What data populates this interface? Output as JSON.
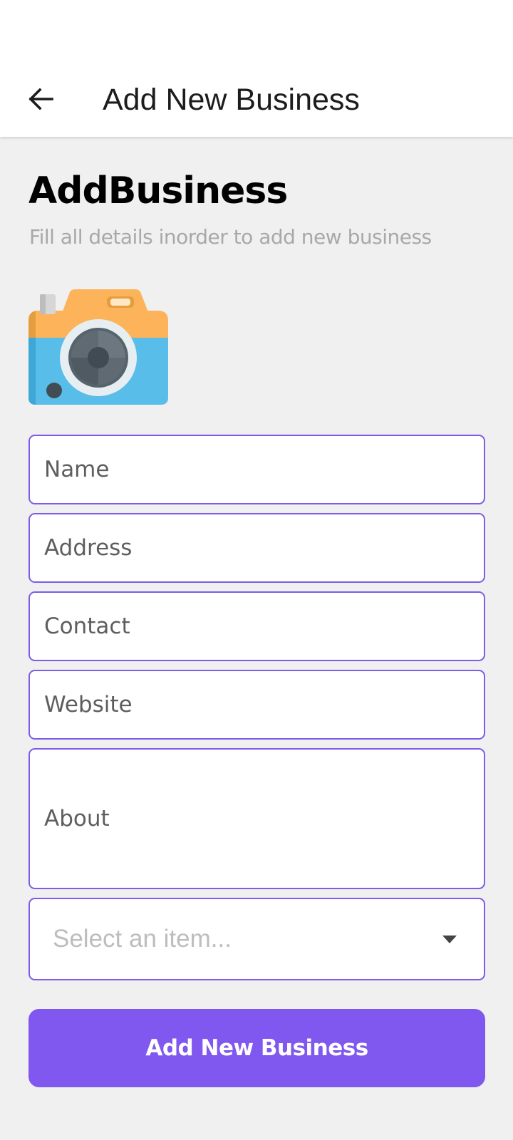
{
  "app_bar": {
    "title": "Add New Business",
    "back_icon": "arrow-left-icon"
  },
  "form": {
    "heading": "AddBusiness",
    "subheading": "Fill all details inorder to add new business",
    "image_icon": "camera-icon",
    "fields": {
      "name": {
        "placeholder": "Name",
        "value": ""
      },
      "address": {
        "placeholder": "Address",
        "value": ""
      },
      "contact": {
        "placeholder": "Contact",
        "value": ""
      },
      "website": {
        "placeholder": "Website",
        "value": ""
      },
      "about": {
        "placeholder": "About",
        "value": ""
      }
    },
    "category_select": {
      "placeholder": "Select an item...",
      "icon": "caret-down-icon"
    },
    "submit_label": "Add New Business"
  },
  "colors": {
    "accent": "#8057ef",
    "field_border": "#7e5be8",
    "background": "#f0f0f0",
    "camera_top": "#fcb35a",
    "camera_body": "#58bde9"
  }
}
